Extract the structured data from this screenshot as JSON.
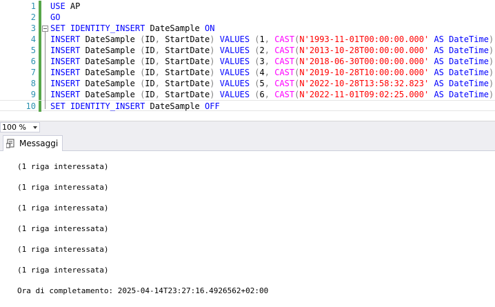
{
  "editor": {
    "line_numbers": [
      "1",
      "2",
      "3",
      "4",
      "5",
      "6",
      "7",
      "8",
      "9",
      "10"
    ],
    "lines": [
      [
        {
          "t": "USE",
          "c": "kw"
        },
        {
          "t": " AP",
          "c": ""
        }
      ],
      [
        {
          "t": "GO",
          "c": "kw"
        }
      ],
      [
        {
          "t": "SET",
          "c": "kw"
        },
        {
          "t": " ",
          "c": ""
        },
        {
          "t": "IDENTITY_INSERT",
          "c": "kw"
        },
        {
          "t": " DateSample ",
          "c": ""
        },
        {
          "t": "ON",
          "c": "kw"
        }
      ],
      [
        {
          "t": "INSERT",
          "c": "kw"
        },
        {
          "t": " DateSample ",
          "c": ""
        },
        {
          "t": "(",
          "c": "op"
        },
        {
          "t": "ID",
          "c": ""
        },
        {
          "t": ",",
          "c": "op"
        },
        {
          "t": " StartDate",
          "c": ""
        },
        {
          "t": ")",
          "c": "op"
        },
        {
          "t": " ",
          "c": ""
        },
        {
          "t": "VALUES",
          "c": "kw"
        },
        {
          "t": " ",
          "c": ""
        },
        {
          "t": "(",
          "c": "op"
        },
        {
          "t": "1",
          "c": ""
        },
        {
          "t": ",",
          "c": "op"
        },
        {
          "t": " ",
          "c": ""
        },
        {
          "t": "CAST",
          "c": "fn"
        },
        {
          "t": "(",
          "c": "op"
        },
        {
          "t": "N'1993-11-01T00:00:00.000'",
          "c": "str"
        },
        {
          "t": " ",
          "c": ""
        },
        {
          "t": "AS",
          "c": "kw"
        },
        {
          "t": " ",
          "c": ""
        },
        {
          "t": "DateTime",
          "c": "kw"
        },
        {
          "t": "))",
          "c": "op"
        }
      ],
      [
        {
          "t": "INSERT",
          "c": "kw"
        },
        {
          "t": " DateSample ",
          "c": ""
        },
        {
          "t": "(",
          "c": "op"
        },
        {
          "t": "ID",
          "c": ""
        },
        {
          "t": ",",
          "c": "op"
        },
        {
          "t": " StartDate",
          "c": ""
        },
        {
          "t": ")",
          "c": "op"
        },
        {
          "t": " ",
          "c": ""
        },
        {
          "t": "VALUES",
          "c": "kw"
        },
        {
          "t": " ",
          "c": ""
        },
        {
          "t": "(",
          "c": "op"
        },
        {
          "t": "2",
          "c": ""
        },
        {
          "t": ",",
          "c": "op"
        },
        {
          "t": " ",
          "c": ""
        },
        {
          "t": "CAST",
          "c": "fn"
        },
        {
          "t": "(",
          "c": "op"
        },
        {
          "t": "N'2013-10-28T00:00:00.000'",
          "c": "str"
        },
        {
          "t": " ",
          "c": ""
        },
        {
          "t": "AS",
          "c": "kw"
        },
        {
          "t": " ",
          "c": ""
        },
        {
          "t": "DateTime",
          "c": "kw"
        },
        {
          "t": "))",
          "c": "op"
        }
      ],
      [
        {
          "t": "INSERT",
          "c": "kw"
        },
        {
          "t": " DateSample ",
          "c": ""
        },
        {
          "t": "(",
          "c": "op"
        },
        {
          "t": "ID",
          "c": ""
        },
        {
          "t": ",",
          "c": "op"
        },
        {
          "t": " StartDate",
          "c": ""
        },
        {
          "t": ")",
          "c": "op"
        },
        {
          "t": " ",
          "c": ""
        },
        {
          "t": "VALUES",
          "c": "kw"
        },
        {
          "t": " ",
          "c": ""
        },
        {
          "t": "(",
          "c": "op"
        },
        {
          "t": "3",
          "c": ""
        },
        {
          "t": ",",
          "c": "op"
        },
        {
          "t": " ",
          "c": ""
        },
        {
          "t": "CAST",
          "c": "fn"
        },
        {
          "t": "(",
          "c": "op"
        },
        {
          "t": "N'2018-06-30T00:00:00.000'",
          "c": "str"
        },
        {
          "t": " ",
          "c": ""
        },
        {
          "t": "AS",
          "c": "kw"
        },
        {
          "t": " ",
          "c": ""
        },
        {
          "t": "DateTime",
          "c": "kw"
        },
        {
          "t": "))",
          "c": "op"
        }
      ],
      [
        {
          "t": "INSERT",
          "c": "kw"
        },
        {
          "t": " DateSample ",
          "c": ""
        },
        {
          "t": "(",
          "c": "op"
        },
        {
          "t": "ID",
          "c": ""
        },
        {
          "t": ",",
          "c": "op"
        },
        {
          "t": " StartDate",
          "c": ""
        },
        {
          "t": ")",
          "c": "op"
        },
        {
          "t": " ",
          "c": ""
        },
        {
          "t": "VALUES",
          "c": "kw"
        },
        {
          "t": " ",
          "c": ""
        },
        {
          "t": "(",
          "c": "op"
        },
        {
          "t": "4",
          "c": ""
        },
        {
          "t": ",",
          "c": "op"
        },
        {
          "t": " ",
          "c": ""
        },
        {
          "t": "CAST",
          "c": "fn"
        },
        {
          "t": "(",
          "c": "op"
        },
        {
          "t": "N'2019-10-28T10:00:00.000'",
          "c": "str"
        },
        {
          "t": " ",
          "c": ""
        },
        {
          "t": "AS",
          "c": "kw"
        },
        {
          "t": " ",
          "c": ""
        },
        {
          "t": "DateTime",
          "c": "kw"
        },
        {
          "t": "))",
          "c": "op"
        }
      ],
      [
        {
          "t": "INSERT",
          "c": "kw"
        },
        {
          "t": " DateSample ",
          "c": ""
        },
        {
          "t": "(",
          "c": "op"
        },
        {
          "t": "ID",
          "c": ""
        },
        {
          "t": ",",
          "c": "op"
        },
        {
          "t": " StartDate",
          "c": ""
        },
        {
          "t": ")",
          "c": "op"
        },
        {
          "t": " ",
          "c": ""
        },
        {
          "t": "VALUES",
          "c": "kw"
        },
        {
          "t": " ",
          "c": ""
        },
        {
          "t": "(",
          "c": "op"
        },
        {
          "t": "5",
          "c": ""
        },
        {
          "t": ",",
          "c": "op"
        },
        {
          "t": " ",
          "c": ""
        },
        {
          "t": "CAST",
          "c": "fn"
        },
        {
          "t": "(",
          "c": "op"
        },
        {
          "t": "N'2022-10-28T13:58:32.823'",
          "c": "str"
        },
        {
          "t": " ",
          "c": ""
        },
        {
          "t": "AS",
          "c": "kw"
        },
        {
          "t": " ",
          "c": ""
        },
        {
          "t": "DateTime",
          "c": "kw"
        },
        {
          "t": "))",
          "c": "op"
        }
      ],
      [
        {
          "t": "INSERT",
          "c": "kw"
        },
        {
          "t": " DateSample ",
          "c": ""
        },
        {
          "t": "(",
          "c": "op"
        },
        {
          "t": "ID",
          "c": ""
        },
        {
          "t": ",",
          "c": "op"
        },
        {
          "t": " StartDate",
          "c": ""
        },
        {
          "t": ")",
          "c": "op"
        },
        {
          "t": " ",
          "c": ""
        },
        {
          "t": "VALUES",
          "c": "kw"
        },
        {
          "t": " ",
          "c": ""
        },
        {
          "t": "(",
          "c": "op"
        },
        {
          "t": "6",
          "c": ""
        },
        {
          "t": ",",
          "c": "op"
        },
        {
          "t": " ",
          "c": ""
        },
        {
          "t": "CAST",
          "c": "fn"
        },
        {
          "t": "(",
          "c": "op"
        },
        {
          "t": "N'2022-11-01T09:02:25.000'",
          "c": "str"
        },
        {
          "t": " ",
          "c": ""
        },
        {
          "t": "AS",
          "c": "kw"
        },
        {
          "t": " ",
          "c": ""
        },
        {
          "t": "DateTime",
          "c": "kw"
        },
        {
          "t": "))",
          "c": "op"
        }
      ],
      [
        {
          "t": "SET",
          "c": "kw"
        },
        {
          "t": " ",
          "c": ""
        },
        {
          "t": "IDENTITY_INSERT",
          "c": "kw"
        },
        {
          "t": " DateSample ",
          "c": ""
        },
        {
          "t": "OFF",
          "c": "kw"
        }
      ]
    ]
  },
  "zoom": {
    "value": "100 %"
  },
  "tabs": {
    "messages_label": "Messaggi"
  },
  "messages": {
    "rows": [
      "(1 riga interessata)",
      "(1 riga interessata)",
      "(1 riga interessata)",
      "(1 riga interessata)",
      "(1 riga interessata)",
      "(1 riga interessata)"
    ],
    "completion": "Ora di completamento: 2025-04-14T23:27:16.4926562+02:00"
  },
  "colors": {
    "keyword": "#0000ff",
    "function": "#ff00ff",
    "string": "#ff0000",
    "operator": "#808080",
    "line_number": "#2b91af",
    "change_bar": "#57a64a"
  },
  "icons": {
    "messages_tab": "messages-icon",
    "zoom_dropdown": "chevron-down-icon",
    "fold": "collapse-icon"
  }
}
